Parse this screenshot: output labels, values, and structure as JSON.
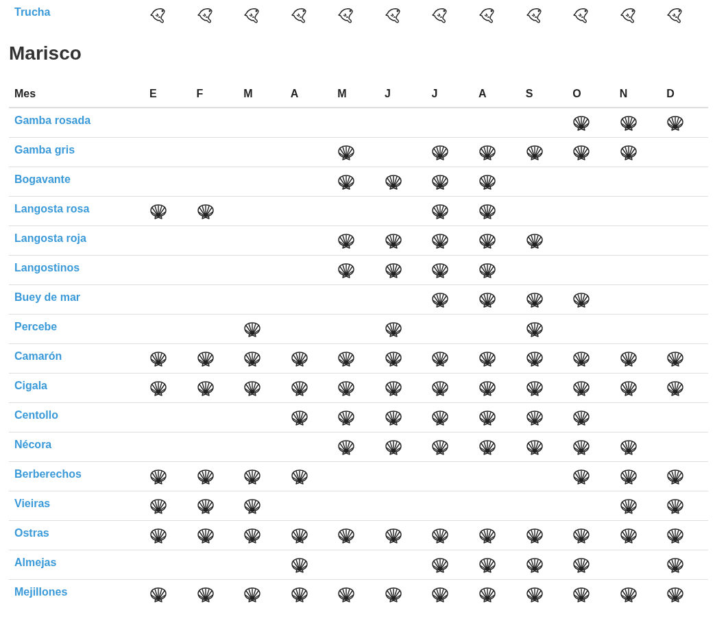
{
  "sections": [
    {
      "kind": "fish",
      "rows": [
        {
          "name": "Trucha",
          "in_season": [
            true,
            true,
            true,
            true,
            true,
            true,
            true,
            true,
            true,
            true,
            true,
            true
          ]
        }
      ]
    },
    {
      "kind": "shellfish",
      "title": "Marisco",
      "columns": [
        "Mes",
        "E",
        "F",
        "M",
        "A",
        "M",
        "J",
        "J",
        "A",
        "S",
        "O",
        "N",
        "D"
      ],
      "rows": [
        {
          "name": "Gamba rosada",
          "in_season": [
            false,
            false,
            false,
            false,
            false,
            false,
            false,
            false,
            false,
            true,
            true,
            true
          ]
        },
        {
          "name": "Gamba gris",
          "in_season": [
            false,
            false,
            false,
            false,
            true,
            false,
            true,
            true,
            true,
            true,
            true,
            false
          ]
        },
        {
          "name": "Bogavante",
          "in_season": [
            false,
            false,
            false,
            false,
            true,
            true,
            true,
            true,
            false,
            false,
            false,
            false
          ]
        },
        {
          "name": "Langosta rosa",
          "in_season": [
            true,
            true,
            false,
            false,
            false,
            false,
            true,
            true,
            false,
            false,
            false,
            false
          ]
        },
        {
          "name": "Langosta roja",
          "in_season": [
            false,
            false,
            false,
            false,
            true,
            true,
            true,
            true,
            true,
            false,
            false,
            false
          ]
        },
        {
          "name": "Langostinos",
          "in_season": [
            false,
            false,
            false,
            false,
            true,
            true,
            true,
            true,
            false,
            false,
            false,
            false
          ]
        },
        {
          "name": "Buey de mar",
          "in_season": [
            false,
            false,
            false,
            false,
            false,
            false,
            true,
            true,
            true,
            true,
            false,
            false
          ]
        },
        {
          "name": "Percebe",
          "in_season": [
            false,
            false,
            true,
            false,
            false,
            true,
            false,
            false,
            true,
            false,
            false,
            false
          ]
        },
        {
          "name": "Camarón",
          "in_season": [
            true,
            true,
            true,
            true,
            true,
            true,
            true,
            true,
            true,
            true,
            true,
            true
          ]
        },
        {
          "name": "Cigala",
          "in_season": [
            true,
            true,
            true,
            true,
            true,
            true,
            true,
            true,
            true,
            true,
            true,
            true
          ]
        },
        {
          "name": "Centollo",
          "in_season": [
            false,
            false,
            false,
            true,
            true,
            true,
            true,
            true,
            true,
            true,
            false,
            false
          ]
        },
        {
          "name": "Nécora",
          "in_season": [
            false,
            false,
            false,
            false,
            true,
            true,
            true,
            true,
            true,
            true,
            true,
            false
          ]
        },
        {
          "name": "Berberechos",
          "in_season": [
            true,
            true,
            true,
            true,
            false,
            false,
            false,
            false,
            false,
            true,
            true,
            true
          ]
        },
        {
          "name": "Vieiras",
          "in_season": [
            true,
            true,
            true,
            false,
            false,
            false,
            false,
            false,
            false,
            false,
            true,
            true
          ]
        },
        {
          "name": "Ostras",
          "in_season": [
            true,
            true,
            true,
            true,
            true,
            true,
            true,
            true,
            true,
            true,
            true,
            true
          ]
        },
        {
          "name": "Almejas",
          "in_season": [
            false,
            false,
            false,
            true,
            false,
            false,
            true,
            true,
            true,
            true,
            false,
            true
          ]
        },
        {
          "name": "Mejillones",
          "in_season": [
            true,
            true,
            true,
            true,
            true,
            true,
            true,
            true,
            true,
            true,
            true,
            true
          ]
        }
      ]
    }
  ]
}
